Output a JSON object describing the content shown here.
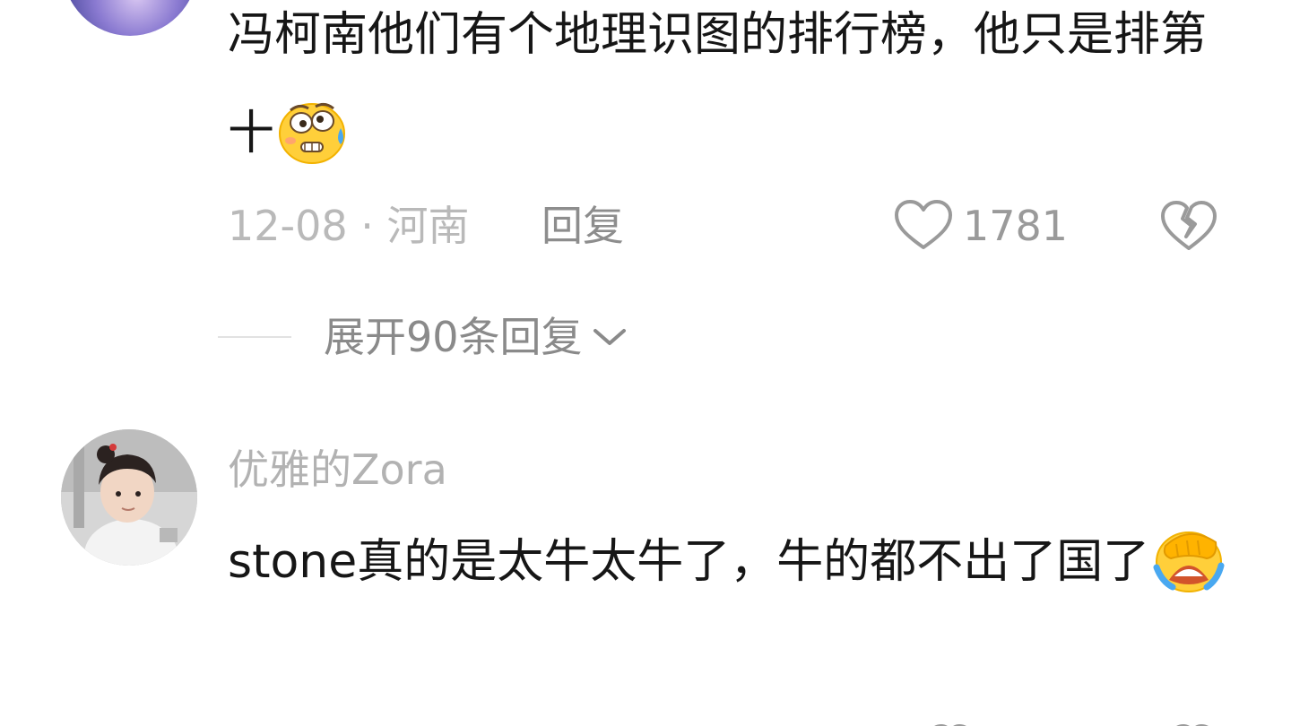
{
  "comments": [
    {
      "text": "冯柯南他们有个地理识图的排行榜，他只是排第十",
      "emoji": "woozy-sweat-emoji",
      "time_location": "12-08 · 河南",
      "reply_label": "回复",
      "like_count": "1781",
      "expand_label": "展开90条回复"
    },
    {
      "username": "优雅的Zora",
      "text": "stone真的是太牛太牛了，牛的都不出了国了",
      "emoji": "facepalm-crying-emoji"
    }
  ],
  "icons": {
    "like": "heart-outline-icon",
    "dislike": "broken-heart-icon",
    "expand": "chevron-down-icon"
  },
  "colors": {
    "text_primary": "#161616",
    "text_meta": "#b9b9b9",
    "text_secondary": "#8a8a8a"
  }
}
